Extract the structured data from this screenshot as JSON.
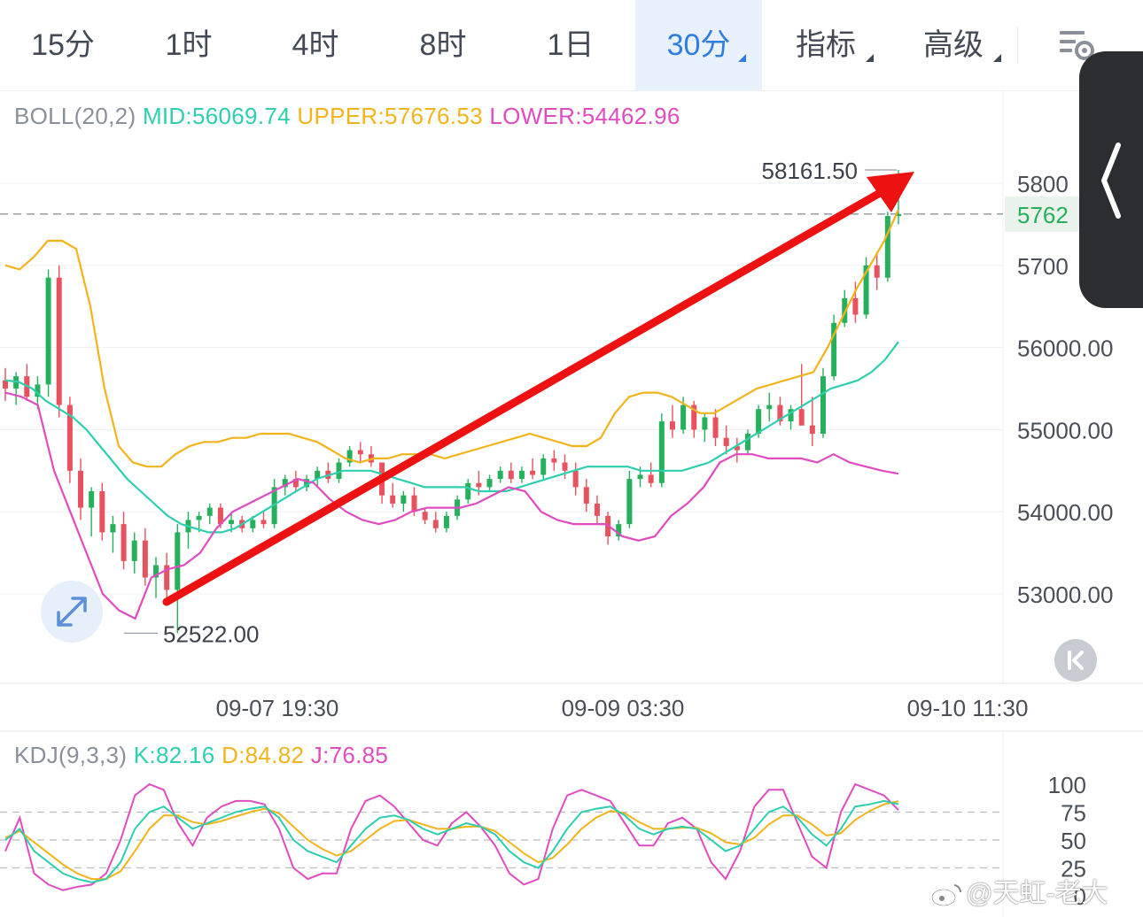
{
  "tabs": [
    {
      "label": "15分",
      "active": false,
      "has_menu": false
    },
    {
      "label": "1时",
      "active": false,
      "has_menu": false
    },
    {
      "label": "4时",
      "active": false,
      "has_menu": false
    },
    {
      "label": "8时",
      "active": false,
      "has_menu": false
    },
    {
      "label": "1日",
      "active": false,
      "has_menu": false
    },
    {
      "label": "30分",
      "active": true,
      "has_menu": true
    },
    {
      "label": "指标",
      "active": false,
      "has_menu": true
    },
    {
      "label": "高级",
      "active": false,
      "has_menu": true
    }
  ],
  "icons": {
    "settings": "chart-settings-icon",
    "side_panel": "chevron-left-icon",
    "expand": "expand-arrows-icon",
    "back_to_latest": "skip-to-latest-icon",
    "watermark": "weibo-logo-icon"
  },
  "boll": {
    "name": "BOLL(20,2)",
    "mid": "MID:56069.74",
    "upper": "UPPER:57676.53",
    "lower": "LOWER:54462.96"
  },
  "kdj": {
    "name": "KDJ(9,3,3)",
    "k": "K:82.16",
    "d": "D:84.82",
    "j": "J:76.85"
  },
  "price_axis": {
    "ticks": [
      {
        "label": "5800",
        "value": 58000
      },
      {
        "label": "5700",
        "value": 57000
      },
      {
        "label": "56000.00",
        "value": 56000
      },
      {
        "label": "55000.00",
        "value": 55000
      },
      {
        "label": "54000.00",
        "value": 54000
      },
      {
        "label": "53000.00",
        "value": 53000
      }
    ],
    "current_label": "5762",
    "current_value": 57625
  },
  "kdj_axis": {
    "ticks": [
      {
        "label": "100",
        "value": 100
      },
      {
        "label": "75",
        "value": 75
      },
      {
        "label": "50",
        "value": 50
      },
      {
        "label": "25",
        "value": 25
      },
      {
        "label": "0",
        "value": 0
      }
    ]
  },
  "time_axis": [
    "09-07 19:30",
    "09-09 03:30",
    "09-10 11:30"
  ],
  "annotations": {
    "high_label": "58161.50",
    "high_value": 58161.5,
    "low_label": "52522.00",
    "low_value": 52522.0
  },
  "watermark": "@天虹-老大",
  "colors": {
    "mid": "#2ecfae",
    "upper": "#f3b31b",
    "lower": "#e04cc0",
    "up": "#27b05c",
    "down": "#e8525e",
    "arrow": "#ee1111",
    "active_tab": "#2f7de1"
  },
  "chart_data": {
    "type": "candlestick",
    "interval": "30分",
    "candles": [
      [
        55600,
        55750,
        55350,
        55500
      ],
      [
        55500,
        55700,
        55300,
        55650
      ],
      [
        55650,
        55800,
        55350,
        55400
      ],
      [
        55400,
        55650,
        55250,
        55550
      ],
      [
        55550,
        56950,
        55400,
        56850
      ],
      [
        56850,
        57000,
        55150,
        55300
      ],
      [
        55300,
        55400,
        54350,
        54500
      ],
      [
        54500,
        54650,
        53900,
        54050
      ],
      [
        54050,
        54300,
        53700,
        54250
      ],
      [
        54250,
        54350,
        53650,
        53750
      ],
      [
        53750,
        53950,
        53500,
        53850
      ],
      [
        53850,
        54000,
        53300,
        53400
      ],
      [
        53400,
        53750,
        53250,
        53650
      ],
      [
        53650,
        53800,
        53100,
        53200
      ],
      [
        53200,
        53450,
        52950,
        53350
      ],
      [
        53350,
        53500,
        52950,
        53050
      ],
      [
        53050,
        53850,
        52522,
        53750
      ],
      [
        53750,
        54000,
        53550,
        53900
      ],
      [
        53900,
        54000,
        53750,
        53950
      ],
      [
        53950,
        54100,
        53850,
        54050
      ],
      [
        54050,
        54100,
        53800,
        53850
      ],
      [
        53850,
        54000,
        53750,
        53900
      ],
      [
        53900,
        53950,
        53750,
        53800
      ],
      [
        53800,
        53950,
        53750,
        53900
      ],
      [
        53900,
        54000,
        53800,
        53850
      ],
      [
        53850,
        54400,
        53800,
        54300
      ],
      [
        54300,
        54450,
        54200,
        54400
      ],
      [
        54400,
        54500,
        54250,
        54300
      ],
      [
        54300,
        54450,
        54250,
        54400
      ],
      [
        54400,
        54550,
        54300,
        54500
      ],
      [
        54500,
        54600,
        54350,
        54400
      ],
      [
        54400,
        54650,
        54350,
        54600
      ],
      [
        54600,
        54800,
        54550,
        54750
      ],
      [
        54750,
        54850,
        54600,
        54700
      ],
      [
        54700,
        54800,
        54550,
        54600
      ],
      [
        54600,
        54500,
        54100,
        54200
      ],
      [
        54200,
        54350,
        54050,
        54100
      ],
      [
        54100,
        54250,
        54000,
        54200
      ],
      [
        54200,
        54300,
        53950,
        54000
      ],
      [
        54000,
        54050,
        53850,
        53900
      ],
      [
        53900,
        54000,
        53750,
        53800
      ],
      [
        53800,
        54000,
        53750,
        53950
      ],
      [
        53950,
        54200,
        53900,
        54150
      ],
      [
        54150,
        54400,
        54100,
        54350
      ],
      [
        54350,
        54500,
        54200,
        54300
      ],
      [
        54300,
        54450,
        54250,
        54400
      ],
      [
        54400,
        54550,
        54350,
        54500
      ],
      [
        54500,
        54600,
        54350,
        54400
      ],
      [
        54400,
        54550,
        54350,
        54500
      ],
      [
        54500,
        54650,
        54400,
        54450
      ],
      [
        54450,
        54700,
        54400,
        54650
      ],
      [
        54650,
        54750,
        54500,
        54600
      ],
      [
        54600,
        54700,
        54400,
        54500
      ],
      [
        54500,
        54600,
        54200,
        54300
      ],
      [
        54300,
        54400,
        54000,
        54100
      ],
      [
        54100,
        54200,
        53850,
        53950
      ],
      [
        53950,
        54000,
        53600,
        53700
      ],
      [
        53700,
        53900,
        53650,
        53850
      ],
      [
        53850,
        54500,
        53800,
        54400
      ],
      [
        54400,
        54550,
        54300,
        54450
      ],
      [
        54450,
        54600,
        54300,
        54350
      ],
      [
        54350,
        55200,
        54300,
        55100
      ],
      [
        55100,
        55300,
        54900,
        55000
      ],
      [
        55000,
        55400,
        54950,
        55300
      ],
      [
        55300,
        55350,
        54900,
        55000
      ],
      [
        55000,
        55200,
        54850,
        55150
      ],
      [
        55150,
        55250,
        54800,
        54900
      ],
      [
        54900,
        55050,
        54700,
        54800
      ],
      [
        54800,
        54900,
        54600,
        54750
      ],
      [
        54750,
        55000,
        54700,
        54950
      ],
      [
        54950,
        55300,
        54900,
        55250
      ],
      [
        55250,
        55450,
        55100,
        55300
      ],
      [
        55300,
        55400,
        55050,
        55100
      ],
      [
        55100,
        55300,
        55000,
        55250
      ],
      [
        55250,
        55800,
        55100,
        55050
      ],
      [
        55050,
        55400,
        54800,
        54950
      ],
      [
        54950,
        55750,
        54900,
        55650
      ],
      [
        55650,
        56400,
        55600,
        56300
      ],
      [
        56300,
        56700,
        56250,
        56600
      ],
      [
        56600,
        56800,
        56300,
        56400
      ],
      [
        56400,
        57100,
        56350,
        57000
      ],
      [
        57000,
        57150,
        56700,
        56850
      ],
      [
        56850,
        57650,
        56800,
        57600
      ],
      [
        57600,
        58161.5,
        57500,
        57625
      ]
    ],
    "boll_mid": [
      55600,
      55580,
      55500,
      55350,
      55250,
      55150,
      55000,
      54800,
      54600,
      54400,
      54250,
      54100,
      53950,
      53850,
      53800,
      53750,
      53750,
      53800,
      53900,
      54000,
      54100,
      54200,
      54300,
      54400,
      54450,
      54500,
      54500,
      54500,
      54450,
      54400,
      54350,
      54300,
      54300,
      54300,
      54300,
      54250,
      54250,
      54250,
      54300,
      54350,
      54400,
      54450,
      54500,
      54550,
      54550,
      54550,
      54550,
      54500,
      54500,
      54500,
      54500,
      54550,
      54600,
      54700,
      54800,
      54900,
      55000,
      55100,
      55200,
      55300,
      55400,
      55500,
      55550,
      55600,
      55700,
      55850,
      56069.74
    ],
    "boll_upper": [
      57000,
      56950,
      57100,
      57300,
      57300,
      57200,
      56500,
      55500,
      54800,
      54600,
      54550,
      54550,
      54700,
      54800,
      54850,
      54850,
      54900,
      54900,
      54950,
      54950,
      54950,
      54900,
      54850,
      54750,
      54650,
      54600,
      54650,
      54650,
      54700,
      54700,
      54700,
      54650,
      54700,
      54750,
      54800,
      54850,
      54900,
      54950,
      54900,
      54850,
      54800,
      54800,
      54900,
      55200,
      55400,
      55450,
      55450,
      55400,
      55300,
      55200,
      55200,
      55300,
      55400,
      55500,
      55550,
      55600,
      55650,
      55700,
      56000,
      56350,
      56700,
      57000,
      57300,
      57676.53
    ],
    "boll_lower": [
      55450,
      55400,
      55300,
      54500,
      54000,
      53500,
      53000,
      52800,
      52700,
      53200,
      53300,
      53350,
      53500,
      53800,
      54000,
      54100,
      54200,
      54300,
      54400,
      54350,
      54150,
      54000,
      53900,
      53850,
      53900,
      54000,
      54050,
      54050,
      54050,
      54100,
      54200,
      54300,
      54250,
      54000,
      53900,
      53850,
      53850,
      53850,
      53700,
      53650,
      53700,
      53950,
      54100,
      54300,
      54600,
      54700,
      54700,
      54650,
      54650,
      54650,
      54600,
      54700,
      54600,
      54550,
      54500,
      54462.96
    ],
    "kdj_k": [
      50,
      60,
      40,
      30,
      20,
      15,
      12,
      15,
      30,
      60,
      75,
      80,
      70,
      60,
      65,
      70,
      75,
      78,
      80,
      70,
      50,
      40,
      35,
      30,
      45,
      60,
      70,
      72,
      68,
      60,
      55,
      60,
      65,
      62,
      55,
      40,
      30,
      25,
      40,
      60,
      75,
      78,
      80,
      72,
      60,
      55,
      60,
      62,
      60,
      50,
      40,
      45,
      60,
      75,
      80,
      70,
      55,
      45,
      60,
      80,
      82,
      85,
      82.16
    ],
    "kdj_d": [
      52,
      58,
      48,
      38,
      28,
      20,
      15,
      15,
      22,
      40,
      60,
      72,
      72,
      66,
      64,
      67,
      71,
      75,
      78,
      74,
      62,
      50,
      42,
      36,
      40,
      50,
      60,
      67,
      68,
      64,
      60,
      60,
      62,
      62,
      58,
      48,
      38,
      30,
      34,
      46,
      60,
      70,
      76,
      74,
      66,
      60,
      60,
      61,
      61,
      56,
      48,
      46,
      52,
      64,
      72,
      72,
      64,
      54,
      56,
      68,
      76,
      82,
      84.82
    ],
    "kdj_j": [
      40,
      70,
      20,
      10,
      5,
      8,
      10,
      20,
      50,
      90,
      100,
      95,
      65,
      45,
      70,
      80,
      85,
      85,
      82,
      60,
      25,
      15,
      20,
      20,
      60,
      85,
      90,
      80,
      65,
      50,
      45,
      65,
      75,
      62,
      45,
      20,
      10,
      15,
      60,
      90,
      95,
      90,
      85,
      65,
      45,
      45,
      65,
      70,
      60,
      30,
      15,
      40,
      80,
      95,
      95,
      65,
      35,
      25,
      75,
      100,
      95,
      90,
      76.85
    ]
  }
}
